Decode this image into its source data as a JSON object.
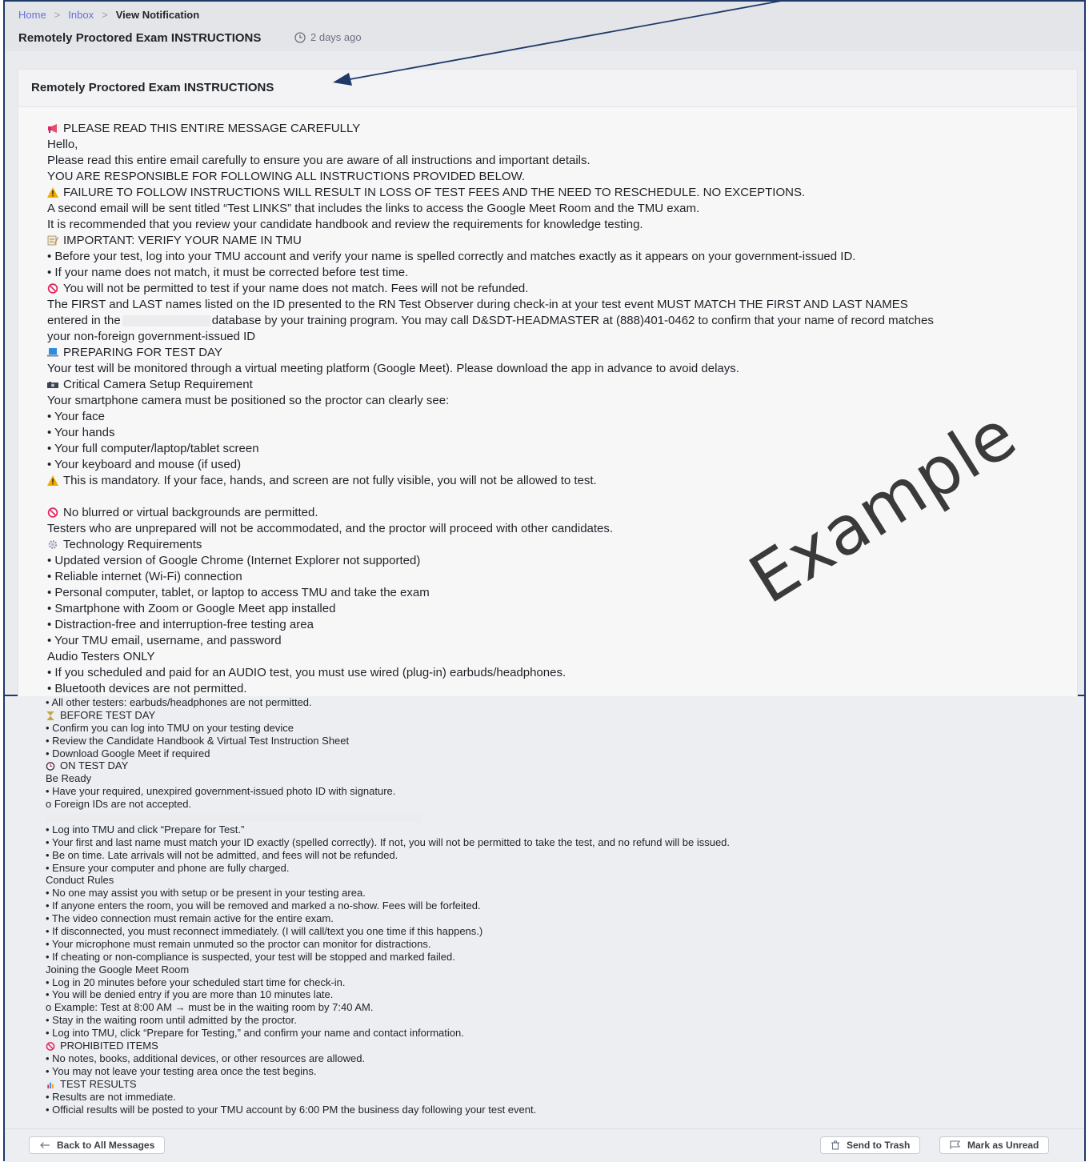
{
  "breadcrumb": {
    "home": "Home",
    "inbox": "Inbox",
    "current": "View Notification",
    "sep": ">"
  },
  "header": {
    "title": "Remotely Proctored Exam INSTRUCTIONS",
    "time": "2 days ago"
  },
  "card": {
    "title": "Remotely Proctored Exam INSTRUCTIONS"
  },
  "watermark": "Example",
  "body_top": [
    "PLEASE READ THIS ENTIRE MESSAGE CAREFULLY",
    "Hello,",
    "Please read this entire email carefully to ensure you are aware of all instructions and important details.",
    "YOU ARE RESPONSIBLE FOR FOLLOWING ALL INSTRUCTIONS PROVIDED BELOW.",
    "FAILURE TO FOLLOW INSTRUCTIONS WILL RESULT IN LOSS OF TEST FEES AND THE NEED TO RESCHEDULE. NO EXCEPTIONS.",
    "A second email will be sent titled “Test LINKS” that includes the links to access the Google Meet Room and the TMU exam.",
    "It is recommended that you review your candidate handbook and review the requirements for knowledge testing.",
    "IMPORTANT: VERIFY YOUR NAME IN TMU",
    "• Before your test, log into your TMU account and verify your name is spelled correctly and matches exactly as it appears on your government-issued ID.",
    "• If your name does not match, it must be corrected before test time.",
    "You will not be permitted to test if your name does not match. Fees will not be refunded.",
    "The FIRST and LAST names listed on the ID presented to the RN Test Observer during check-in at your test event MUST MATCH THE FIRST AND LAST NAMES",
    "entered in the",
    "database by your training program. You may call D&SDT-HEADMASTER at (888)401-0462 to confirm that your name of record matches",
    "your non-foreign government-issued ID",
    "PREPARING FOR TEST DAY",
    "Your test will be monitored through a virtual meeting platform (Google Meet). Please download the app in advance to avoid delays.",
    "Critical Camera Setup Requirement",
    "Your smartphone camera must be positioned so the proctor can clearly see:",
    "• Your face",
    "• Your hands",
    "• Your full computer/laptop/tablet screen",
    "• Your keyboard and mouse (if used)",
    "This is mandatory. If your face, hands, and screen are not fully visible, you will not be allowed to test.",
    "No blurred or virtual backgrounds are permitted.",
    "Testers who are unprepared will not be accommodated, and the proctor will proceed with other candidates.",
    "Technology Requirements",
    "• Updated version of Google Chrome (Internet Explorer not supported)",
    "• Reliable internet (Wi-Fi) connection",
    "• Personal computer, tablet, or laptop to access TMU and take the exam",
    "• Smartphone with Zoom or Google Meet app installed",
    "• Distraction-free and interruption-free testing area",
    "• Your TMU email, username, and password",
    "Audio Testers ONLY",
    "• If you scheduled and paid for an AUDIO test, you must use wired (plug-in) earbuds/headphones.",
    "• Bluetooth devices are not permitted."
  ],
  "body_bottom": [
    "• All other testers: earbuds/headphones are not permitted.",
    "BEFORE TEST DAY",
    "• Confirm you can log into TMU on your testing device",
    "• Review the Candidate Handbook & Virtual Test Instruction Sheet",
    "• Download Google Meet if required",
    "ON TEST DAY",
    "Be Ready",
    "• Have your required, unexpired government-issued photo ID with signature.",
    "o Foreign IDs are not accepted.",
    "• Log into TMU and click “Prepare for Test.”",
    "• Your first and last name must match your ID exactly (spelled correctly). If not, you will not be permitted to take the test, and no refund will be issued.",
    "• Be on time. Late arrivals will not be admitted, and fees will not be refunded.",
    "• Ensure your computer and phone are fully charged.",
    "Conduct Rules",
    "• No one may assist you with setup or be present in your testing area.",
    "• If anyone enters the room, you will be removed and marked a no-show. Fees will be forfeited.",
    "• The video connection must remain active for the entire exam.",
    "• If disconnected, you must reconnect immediately. (I will call/text you one time if this happens.)",
    "• Your microphone must remain unmuted so the proctor can monitor for distractions.",
    "• If cheating or non-compliance is suspected, your test will be stopped and marked failed.",
    "Joining the Google Meet Room",
    "• Log in 20 minutes before your scheduled start time for check-in.",
    "• You will be denied entry if you are more than 10 minutes late.",
    "o Example: Test at 8:00 AM → must be in the waiting room by 7:40 AM.",
    "• Stay in the waiting room until admitted by the proctor.",
    "• Log into TMU, click “Prepare for Testing,” and confirm your name and contact information.",
    "PROHIBITED ITEMS",
    "• No notes, books, additional devices, or other resources are allowed.",
    "• You may not leave your testing area once the test begins.",
    "TEST RESULTS",
    "• Results are not immediate.",
    "• Official results will be posted to your TMU account by 6:00 PM the business day following your test event."
  ],
  "footer": {
    "back": "Back to All Messages",
    "trash": "Send to Trash",
    "unread": "Mark as Unread"
  },
  "colors": {
    "frame": "#1f3a68",
    "link": "#6571d6",
    "warn": "#f2a900",
    "prohibited": "#e0245e"
  }
}
